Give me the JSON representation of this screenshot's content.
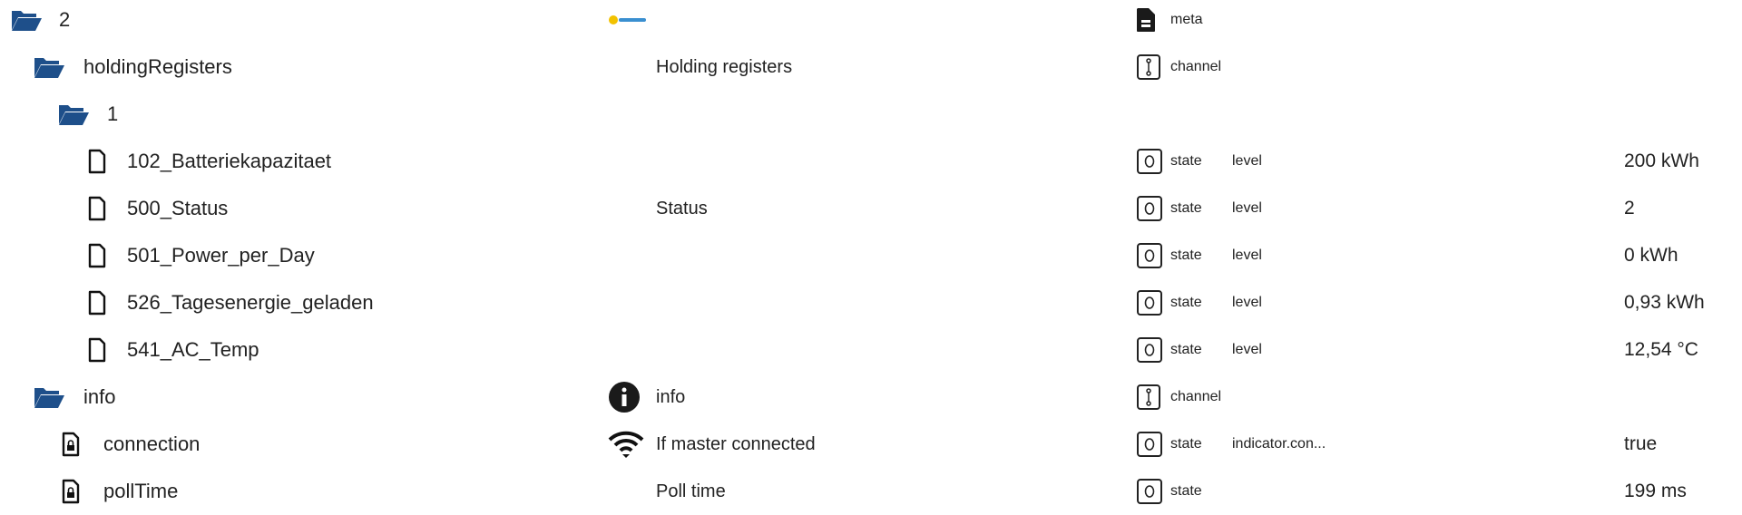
{
  "colors": {
    "folder": "#1e4f8a",
    "icon": "#222222"
  },
  "rows": [
    {
      "name": "2",
      "icon": "folder-open-icon",
      "col2_icon": "adapter-logo",
      "col2": "",
      "type_icon": "meta-file-icon",
      "type": "meta",
      "role": "",
      "value": ""
    },
    {
      "name": "holdingRegisters",
      "icon": "folder-open-icon",
      "col2": "Holding registers",
      "type_icon": "channel-icon",
      "type": "channel",
      "role": "",
      "value": ""
    },
    {
      "name": "1",
      "icon": "folder-open-icon",
      "col2": "",
      "type": "",
      "role": "",
      "value": ""
    },
    {
      "name": "102_Batteriekapazitaet",
      "icon": "file-icon",
      "col2": "",
      "type_icon": "state-icon",
      "type": "state",
      "role": "level",
      "value": "200 kWh"
    },
    {
      "name": "500_Status",
      "icon": "file-icon",
      "col2": "Status",
      "type_icon": "state-icon",
      "type": "state",
      "role": "level",
      "value": "2"
    },
    {
      "name": "501_Power_per_Day",
      "icon": "file-icon",
      "col2": "",
      "type_icon": "state-icon",
      "type": "state",
      "role": "level",
      "value": "0 kWh"
    },
    {
      "name": "526_Tagesenergie_geladen",
      "icon": "file-icon",
      "col2": "",
      "type_icon": "state-icon",
      "type": "state",
      "role": "level",
      "value": "0,93 kWh"
    },
    {
      "name": "541_AC_Temp",
      "icon": "file-icon",
      "col2": "",
      "type_icon": "state-icon",
      "type": "state",
      "role": "level",
      "value": "12,54 °C"
    },
    {
      "name": "info",
      "icon": "folder-open-icon",
      "col2_icon": "info-icon",
      "col2": "info",
      "type_icon": "channel-icon",
      "type": "channel",
      "role": "",
      "value": ""
    },
    {
      "name": "connection",
      "icon": "locked-file-icon",
      "col2_icon": "wifi-icon",
      "col2": "If master connected",
      "type_icon": "state-icon",
      "type": "state",
      "role": "indicator.con...",
      "value": "true"
    },
    {
      "name": "pollTime",
      "icon": "locked-file-icon",
      "col2": "Poll time",
      "type_icon": "state-icon",
      "type": "state",
      "role": "",
      "value": "199 ms"
    }
  ]
}
